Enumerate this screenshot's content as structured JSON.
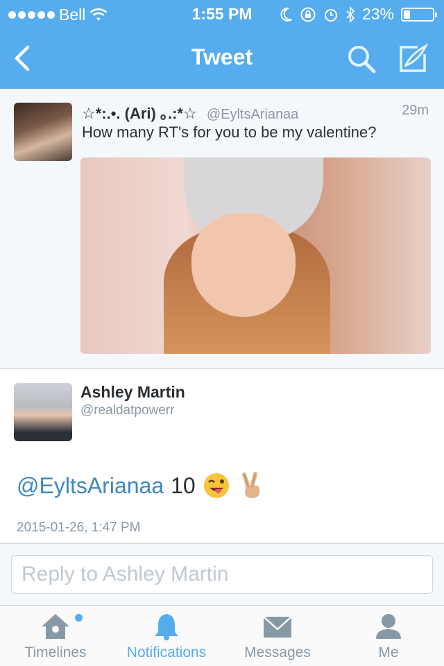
{
  "status_bar": {
    "carrier": "Bell",
    "time": "1:55 PM",
    "battery": "23%",
    "battery_level": 0.23
  },
  "nav": {
    "title": "Tweet",
    "icons": [
      "back-chevron-icon",
      "search-icon",
      "compose-icon"
    ]
  },
  "tweet": {
    "name": "☆*:.•. (Ari) ｡.:*☆",
    "handle": "@EyltsArianaa",
    "age": "29m",
    "text": "How many RT's for you to be my valentine?"
  },
  "reply": {
    "name": "Ashley Martin",
    "handle": "@realdatpowerr",
    "mention": "@EyltsArianaa",
    "count": "10",
    "emojis": [
      "winking-tongue-emoji",
      "victory-hand-emoji"
    ],
    "timestamp": "2015-01-26, 1:47 PM"
  },
  "reply_input": {
    "placeholder": "Reply to Ashley Martin"
  },
  "tabs": [
    {
      "label": "Timelines",
      "icon": "home-icon",
      "active": false,
      "badge": true
    },
    {
      "label": "Notifications",
      "icon": "bell-icon",
      "active": true,
      "badge": false
    },
    {
      "label": "Messages",
      "icon": "envelope-icon",
      "active": false,
      "badge": false
    },
    {
      "label": "Me",
      "icon": "person-icon",
      "active": false,
      "badge": false
    }
  ],
  "colors": {
    "header_blue": "#55acee",
    "link_blue": "#3b88c3",
    "muted_gray": "#8899a6"
  }
}
